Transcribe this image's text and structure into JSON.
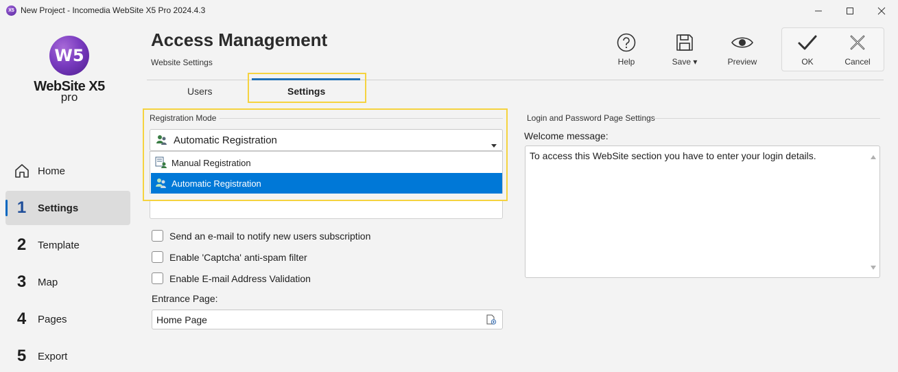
{
  "window": {
    "title": "New Project - Incomedia WebSite X5 Pro 2024.4.3",
    "app_icon_text": "X5"
  },
  "sidebar": {
    "logo_mark": "W5",
    "logo_name": "WebSite X5",
    "logo_edition": "pro",
    "items": [
      {
        "num": "",
        "label": "Home",
        "icon": "home-icon"
      },
      {
        "num": "1",
        "label": "Settings"
      },
      {
        "num": "2",
        "label": "Template"
      },
      {
        "num": "3",
        "label": "Map"
      },
      {
        "num": "4",
        "label": "Pages"
      },
      {
        "num": "5",
        "label": "Export"
      }
    ]
  },
  "header": {
    "title": "Access Management",
    "subtitle": "Website Settings",
    "toolbar": {
      "help": "Help",
      "save": "Save",
      "preview": "Preview",
      "ok": "OK",
      "cancel": "Cancel"
    }
  },
  "tabs": [
    {
      "label": "Users"
    },
    {
      "label": "Settings",
      "active": true
    }
  ],
  "registration": {
    "group_title": "Registration Mode",
    "selected": "Automatic Registration",
    "options": [
      "Manual Registration",
      "Automatic Registration"
    ]
  },
  "checkboxes": [
    {
      "label": "Send an e-mail to notify new users subscription",
      "checked": false
    },
    {
      "label": "Enable 'Captcha' anti-spam filter",
      "checked": false
    },
    {
      "label": "Enable E-mail Address Validation",
      "checked": false
    }
  ],
  "entrance": {
    "label": "Entrance Page:",
    "value": "Home Page"
  },
  "login_settings": {
    "group_title": "Login and Password Page Settings",
    "welcome_label": "Welcome message:",
    "welcome_text": "To access this WebSite section you have to enter your login details."
  },
  "colors": {
    "accent": "#0078d7",
    "highlight": "#f5d33f",
    "active_nav_bg": "#dcdcdc"
  }
}
